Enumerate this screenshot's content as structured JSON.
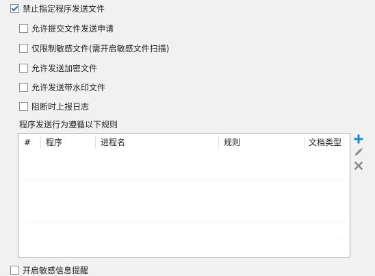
{
  "options": [
    {
      "label": "禁止指定程序发送文件",
      "checked": true
    },
    {
      "label": "允许提交文件发送申请",
      "checked": false
    },
    {
      "label": "仅限制敏感文件(需开启敏感文件扫描)",
      "checked": false
    },
    {
      "label": "允许发送加密文件",
      "checked": false
    },
    {
      "label": "允许发送带水印文件",
      "checked": false
    },
    {
      "label": "阻断时上报日志",
      "checked": false
    }
  ],
  "rules_section": {
    "label": "程序发送行为遵循以下规则"
  },
  "table": {
    "columns": [
      "#",
      "程序",
      "进程名",
      "规则",
      "文档类型"
    ],
    "rows": []
  },
  "actions": {
    "add_icon": "plus-icon",
    "edit_icon": "pencil-icon",
    "delete_icon": "x-icon",
    "add_color": "#1e88d6",
    "edit_color": "#8a8a8a",
    "delete_color": "#8a8a8a"
  },
  "bottom_option": {
    "label": "开启敏感信息提醒",
    "checked": false
  }
}
